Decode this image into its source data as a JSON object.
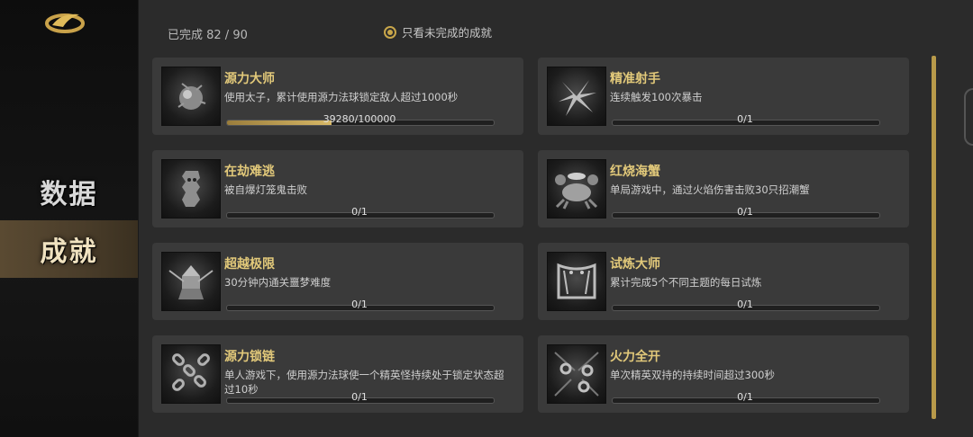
{
  "sidebar": {
    "items": [
      {
        "label": "数据",
        "active": false
      },
      {
        "label": "成就",
        "active": true
      }
    ]
  },
  "header": {
    "completed_label": "已完成",
    "completed": 82,
    "total": 90,
    "completed_text": "已完成 82 / 90",
    "filter_label": "只看未完成的成就",
    "filter_checked": true
  },
  "colors": {
    "accent_gold": "#c8a64a",
    "title_gold": "#e2c97a",
    "card_bg": "#3a3a3a"
  },
  "achievements": [
    {
      "title": "源力大师",
      "desc": "使用太子，累计使用源力法球锁定敌人超过1000秒",
      "progress": "39280/100000",
      "fraction": 0.3928,
      "icon": "orb-icon"
    },
    {
      "title": "精准射手",
      "desc": "连续触发100次暴击",
      "progress": "0/1",
      "fraction": 0,
      "icon": "burst-icon"
    },
    {
      "title": "在劫难逃",
      "desc": "被自爆灯笼鬼击败",
      "progress": "0/1",
      "fraction": 0,
      "icon": "lantern-icon"
    },
    {
      "title": "红烧海蟹",
      "desc": "单局游戏中，通过火焰伤害击败30只招潮蟹",
      "progress": "0/1",
      "fraction": 0,
      "icon": "crab-icon"
    },
    {
      "title": "超越极限",
      "desc": "30分钟内通关噩梦难度",
      "progress": "0/1",
      "fraction": 0,
      "icon": "warrior-icon"
    },
    {
      "title": "试炼大师",
      "desc": "累计完成5个不同主题的每日试炼",
      "progress": "0/1",
      "fraction": 0,
      "icon": "banner-icon"
    },
    {
      "title": "源力锁链",
      "desc": "单人游戏下，使用源力法球使一个精英怪持续处于锁定状态超过10秒",
      "progress": "0/1",
      "fraction": 0,
      "icon": "chain-icon"
    },
    {
      "title": "火力全开",
      "desc": "单次精英双持的持续时间超过300秒",
      "progress": "0/1",
      "fraction": 0,
      "icon": "gears-icon"
    }
  ]
}
